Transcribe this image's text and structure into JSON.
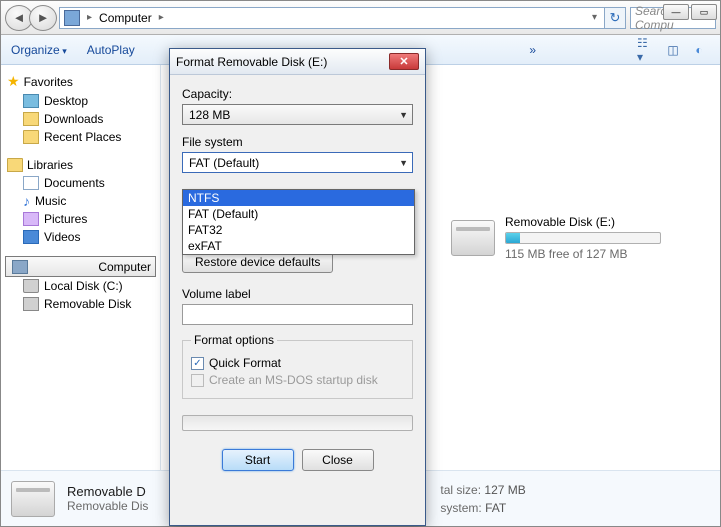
{
  "window": {
    "min": "—",
    "max": "▭"
  },
  "address": {
    "root": "Computer"
  },
  "search": {
    "placeholder": "Search Compu"
  },
  "toolbar": {
    "organize": "Organize",
    "autoplay": "AutoPlay",
    "more": "»"
  },
  "sidebar": {
    "favorites": "Favorites",
    "fav_items": [
      {
        "label": "Desktop"
      },
      {
        "label": "Downloads"
      },
      {
        "label": "Recent Places"
      }
    ],
    "libraries": "Libraries",
    "lib_items": [
      {
        "label": "Documents"
      },
      {
        "label": "Music"
      },
      {
        "label": "Pictures"
      },
      {
        "label": "Videos"
      }
    ],
    "computer": "Computer",
    "comp_items": [
      {
        "label": "Local Disk (C:)"
      },
      {
        "label": "Removable Disk"
      }
    ]
  },
  "content": {
    "drive_name": "Removable Disk (E:)",
    "drive_free": "115 MB free of 127 MB"
  },
  "details": {
    "title": "Removable D",
    "subtitle": "Removable Dis",
    "total_label": "tal size:",
    "total_value": "127 MB",
    "fs_label": "system:",
    "fs_value": "FAT"
  },
  "dialog": {
    "title": "Format Removable Disk (E:)",
    "capacity_label": "Capacity:",
    "capacity_value": "128 MB",
    "fs_label": "File system",
    "fs_value": "FAT (Default)",
    "fs_options": [
      "NTFS",
      "FAT (Default)",
      "FAT32",
      "exFAT"
    ],
    "alloc_label": "",
    "restore_btn": "Restore device defaults",
    "volume_label": "Volume label",
    "volume_value": "",
    "options_legend": "Format options",
    "quick_format": "Quick Format",
    "msdos_disk": "Create an MS-DOS startup disk",
    "start_btn": "Start",
    "close_btn": "Close"
  }
}
